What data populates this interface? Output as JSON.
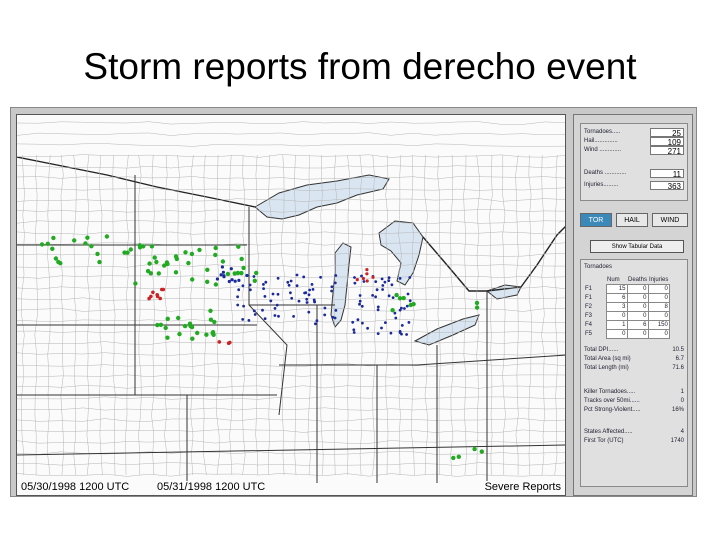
{
  "slide": {
    "title": "Storm reports from derecho event"
  },
  "map": {
    "start_time": "05/30/1998 1200 UTC",
    "end_time": "05/31/1998 1200 UTC",
    "legend": "Severe Reports"
  },
  "summary": {
    "tornadoes_label": "Tornadoes.....",
    "tornadoes": "25",
    "hail_label": "Hail..............",
    "hail": "109",
    "wind_label": "Wind .............",
    "wind": "271",
    "deaths_label": "Deaths .............",
    "deaths": "11",
    "injuries_label": "Injuries.........",
    "injuries": "363"
  },
  "tabs": [
    {
      "label": "TOR",
      "active": true
    },
    {
      "label": "HAIL",
      "active": false
    },
    {
      "label": "WIND",
      "active": false
    }
  ],
  "show_table_button": "Show Tabular Data",
  "tornado_table": {
    "section_label": "Tornadoes",
    "headers": [
      "Num",
      "Deaths",
      "Injuries"
    ],
    "rows": [
      {
        "rating": "F1",
        "num": "15",
        "deaths": "0",
        "injuries": "0"
      },
      {
        "rating": "F1",
        "num": "6",
        "deaths": "0",
        "injuries": "0"
      },
      {
        "rating": "F2",
        "num": "3",
        "deaths": "0",
        "injuries": "8"
      },
      {
        "rating": "F3",
        "num": "0",
        "deaths": "0",
        "injuries": "0"
      },
      {
        "rating": "F4",
        "num": "1",
        "deaths": "6",
        "injuries": "150"
      },
      {
        "rating": "F5",
        "num": "0",
        "deaths": "0",
        "injuries": "0"
      }
    ]
  },
  "stats": [
    {
      "label": "Total DPI......",
      "value": "10.5"
    },
    {
      "label": "Total Area (sq mi)",
      "value": "6.7"
    },
    {
      "label": "Total Length (mi)",
      "value": "71.6"
    },
    {
      "label": "Killer Tornadoes.....",
      "value": "1"
    },
    {
      "label": "Tracks over 50mi......",
      "value": "0"
    },
    {
      "label": "Pct Strong-Violent.....",
      "value": "16%"
    },
    {
      "label": "States Affected.....",
      "value": "4"
    },
    {
      "label": "First Tor (UTC)",
      "value": "1740"
    }
  ]
}
